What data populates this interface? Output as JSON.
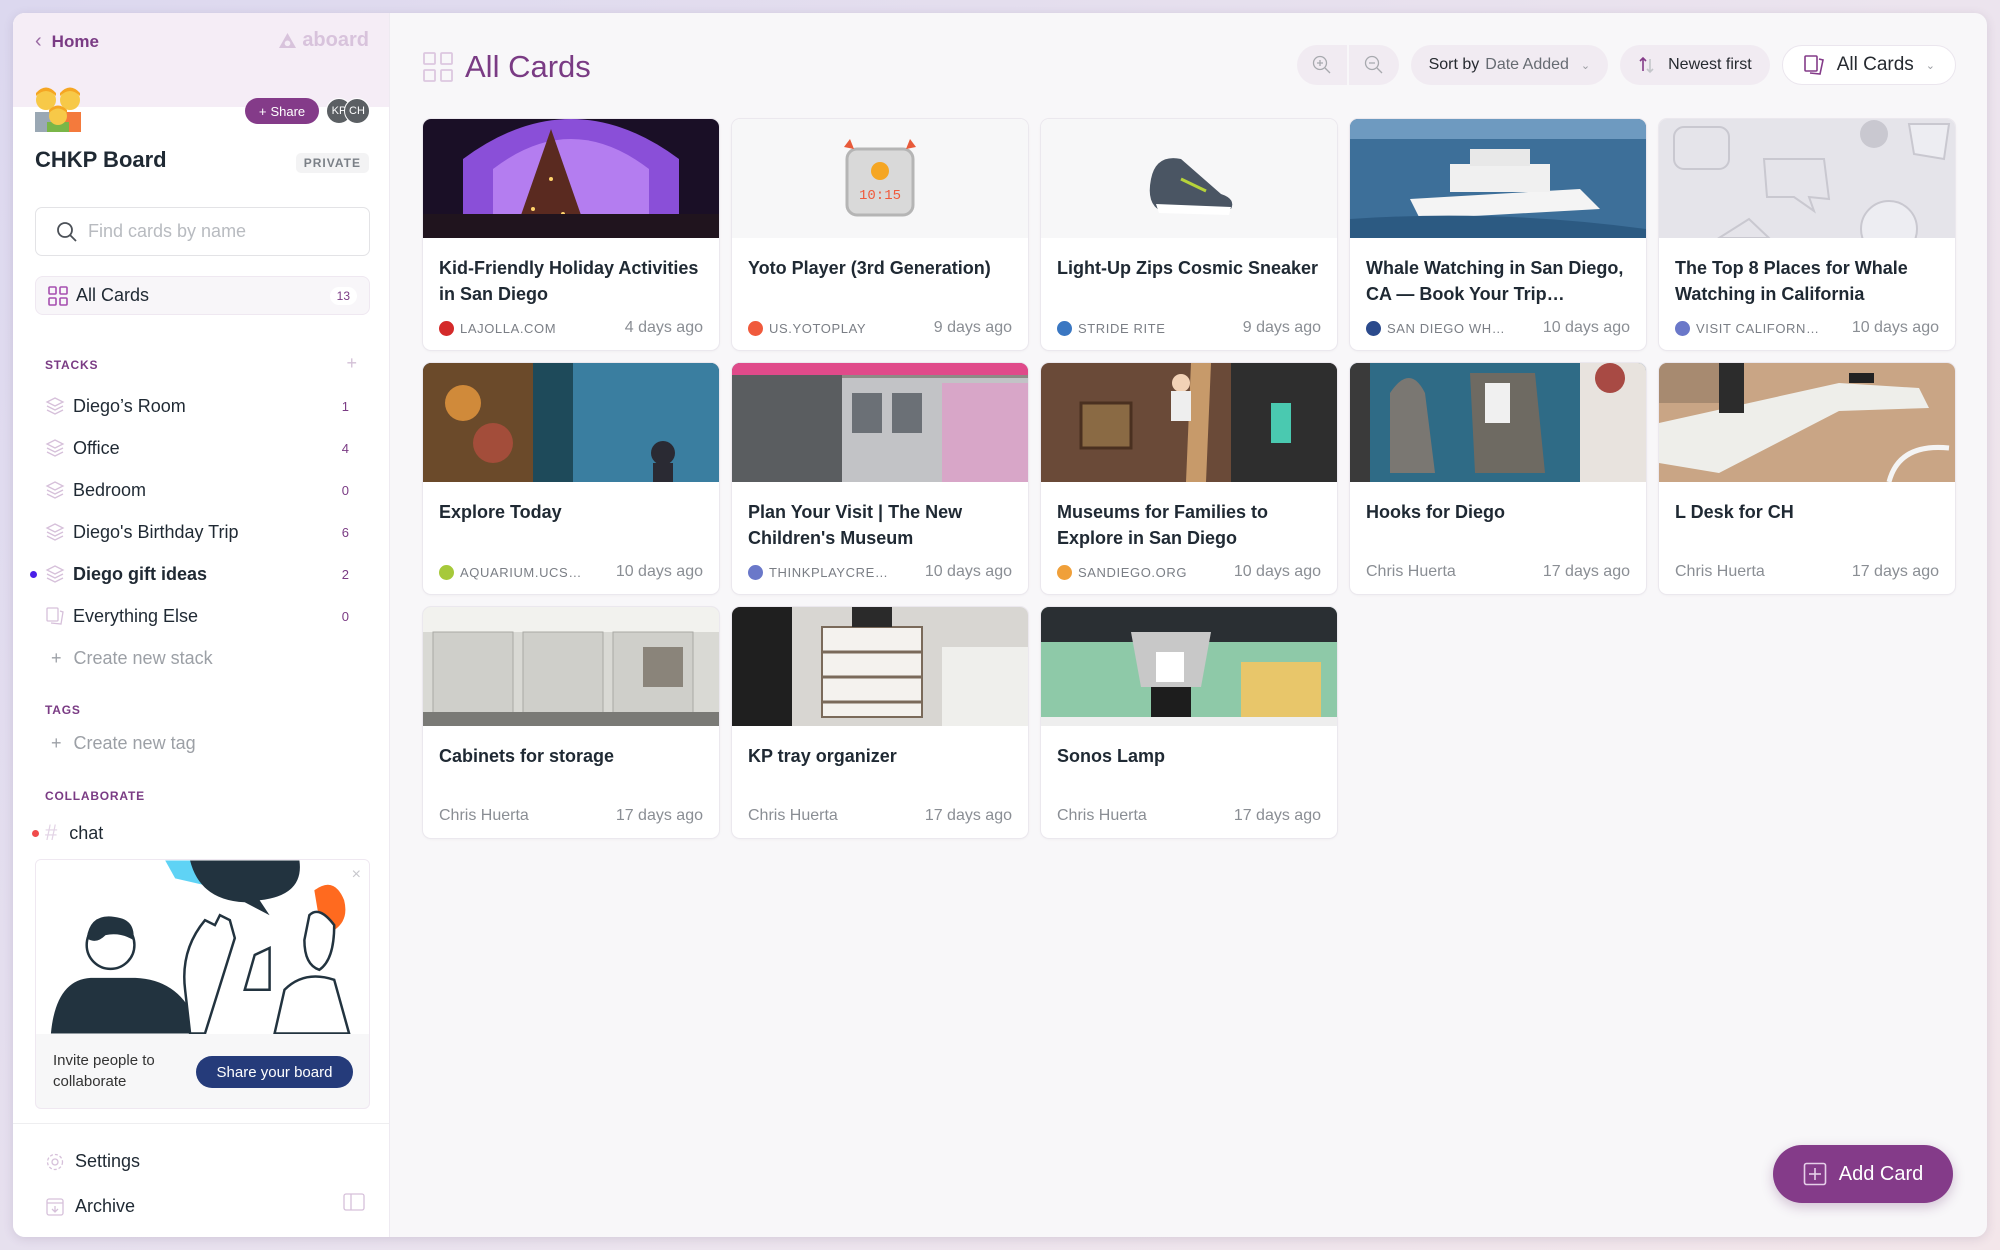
{
  "sidebar": {
    "home_label": "Home",
    "brand": "aboard",
    "share_label": "Share",
    "members": [
      "KP",
      "CH"
    ],
    "board_title": "CHKP Board",
    "visibility": "PRIVATE",
    "search_placeholder": "Find cards by name",
    "all_cards": {
      "label": "All Cards",
      "count": "13"
    },
    "stacks_label": "STACKS",
    "stacks": [
      {
        "name": "Diego’s Room",
        "count": "1",
        "active": false
      },
      {
        "name": "Office",
        "count": "4",
        "active": false
      },
      {
        "name": "Bedroom",
        "count": "0",
        "active": false
      },
      {
        "name": "Diego's Birthday Trip",
        "count": "6",
        "active": false
      },
      {
        "name": "Diego gift ideas",
        "count": "2",
        "active": true
      },
      {
        "name": "Everything Else",
        "count": "0",
        "active": false
      }
    ],
    "create_stack": "Create new stack",
    "tags_label": "TAGS",
    "create_tag": "Create new tag",
    "collaborate_label": "COLLABORATE",
    "chat_label": "chat",
    "invite": {
      "text": "Invite people to collaborate",
      "button": "Share your board"
    },
    "settings_label": "Settings",
    "archive_label": "Archive"
  },
  "main": {
    "title": "All Cards",
    "sort": {
      "prefix": "Sort by",
      "value": "Date Added"
    },
    "order": "Newest first",
    "filter": "All Cards",
    "add_card": "Add Card",
    "colors": {
      "accent": "#843b89",
      "navy": "#253b7a"
    },
    "cards": [
      {
        "title": "Kid-Friendly Holiday Activities in San Diego",
        "source": "LAJOLLA.COM",
        "time": "4 days ago",
        "thumb": "holiday-tree",
        "fav": "#d42a2a"
      },
      {
        "title": "Yoto Player (3rd Generation)",
        "source": "US.YOTOPLAY",
        "time": "9 days ago",
        "thumb": "yoto-player",
        "fav": "#f05a3c"
      },
      {
        "title": "Light-Up Zips Cosmic Sneaker",
        "source": "STRIDE RITE",
        "time": "9 days ago",
        "thumb": "sneaker",
        "fav": "#3a77c2"
      },
      {
        "title": "Whale Watching in San Diego, CA — Book Your Trip…",
        "source": "SAN DIEGO WH…",
        "time": "10 days ago",
        "thumb": "whale-boat",
        "fav": "#2b4a8c"
      },
      {
        "title": "The Top 8 Places for Whale Watching in California",
        "source": "VISIT CALIFORN…",
        "time": "10 days ago",
        "thumb": "placeholder",
        "fav": "#6a78c9"
      },
      {
        "title": "Explore Today",
        "source": "AQUARIUM.UCS…",
        "time": "10 days ago",
        "thumb": "aquarium",
        "fav": "#a6c93a"
      },
      {
        "title": "Plan Your Visit | The New Children's Museum",
        "source": "THINKPLAYCRE…",
        "time": "10 days ago",
        "thumb": "museum",
        "fav": "#6a78c9"
      },
      {
        "title": "Museums for Families to Explore in San Diego",
        "source": "SANDIEGO.ORG",
        "time": "10 days ago",
        "thumb": "ladder",
        "fav": "#f0a03a"
      },
      {
        "title": "Hooks for Diego",
        "author": "Chris Huerta",
        "time": "17 days ago",
        "thumb": "hooks"
      },
      {
        "title": "L Desk for CH",
        "author": "Chris Huerta",
        "time": "17 days ago",
        "thumb": "desk"
      },
      {
        "title": "Cabinets for storage",
        "author": "Chris Huerta",
        "time": "17 days ago",
        "thumb": "cabinets"
      },
      {
        "title": "KP tray organizer",
        "author": "Chris Huerta",
        "time": "17 days ago",
        "thumb": "tray"
      },
      {
        "title": "Sonos Lamp",
        "author": "Chris Huerta",
        "time": "17 days ago",
        "thumb": "lamp"
      }
    ]
  }
}
